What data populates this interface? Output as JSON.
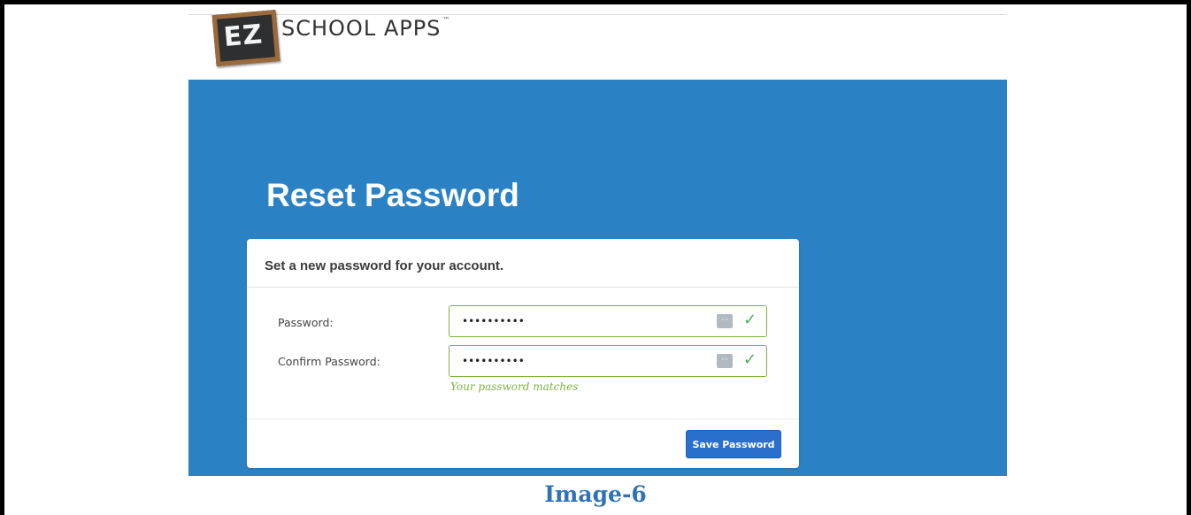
{
  "logo": {
    "mark": "EZ",
    "text": "SCHOOL APPS",
    "trademark": "™"
  },
  "page": {
    "title": "Reset Password"
  },
  "form": {
    "heading": "Set a new password for your account.",
    "password": {
      "label": "Password:",
      "value": "••••••••••"
    },
    "confirm": {
      "label": "Confirm Password:",
      "value": "••••••••••"
    },
    "match_message": "Your password matches",
    "save_label": "Save Password"
  },
  "icons": {
    "password_manager": "password-manager-icon",
    "valid": "checkmark-icon"
  },
  "colors": {
    "hero_background": "#2a82c4",
    "valid_green": "#7cb342",
    "button_blue": "#2a6fcc",
    "caption_blue": "#2e74b5"
  },
  "caption": "Image-6"
}
